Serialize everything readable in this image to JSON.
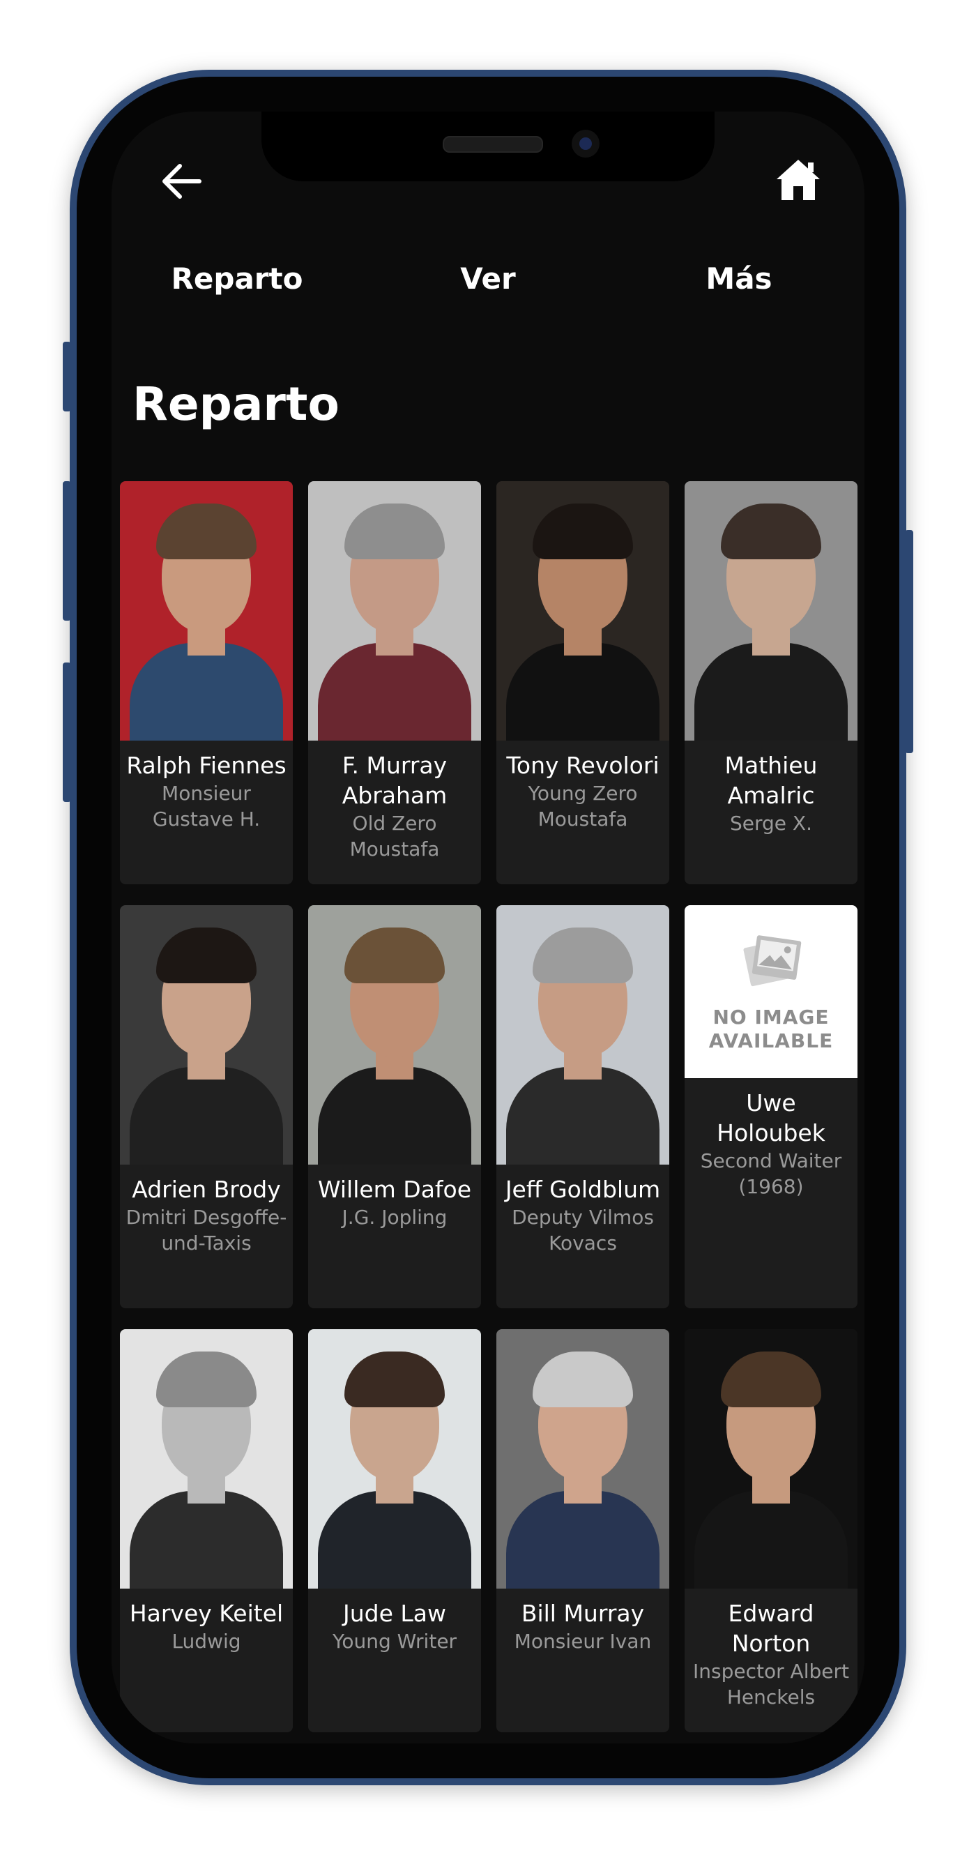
{
  "nav": {
    "back_icon": "arrow-left-icon",
    "home_icon": "home-icon",
    "tabs": [
      {
        "label": "Reparto"
      },
      {
        "label": "Ver"
      },
      {
        "label": "Más"
      }
    ]
  },
  "section": {
    "title": "Reparto"
  },
  "no_image": {
    "line1": "NO IMAGE",
    "line2": "AVAILABLE"
  },
  "cast": [
    {
      "name": "Ralph Fiennes",
      "role": "Monsieur Gustave H.",
      "bg": "#b0222a",
      "skin": "#c99a7e",
      "hair": "#5b4331",
      "cloth": "#2d4a6e"
    },
    {
      "name": "F. Murray Abraham",
      "role": "Old Zero Moustafa",
      "bg": "#bfbfbf",
      "skin": "#c49a86",
      "hair": "#8e8e8e",
      "cloth": "#6a2730"
    },
    {
      "name": "Tony Revolori",
      "role": "Young Zero Moustafa",
      "bg": "#2b2622",
      "skin": "#b58466",
      "hair": "#1b1512",
      "cloth": "#111111"
    },
    {
      "name": "Mathieu Amalric",
      "role": "Serge X.",
      "bg": "#8f8f8f",
      "skin": "#c7a690",
      "hair": "#3a2e28",
      "cloth": "#1b1b1b"
    },
    {
      "name": "Adrien Brody",
      "role": "Dmitri Desgoffe-und-Taxis",
      "bg": "#3a3a3a",
      "skin": "#c9a28a",
      "hair": "#1d1714",
      "cloth": "#202020"
    },
    {
      "name": "Willem Dafoe",
      "role": "J.G. Jopling",
      "bg": "#9ea19c",
      "skin": "#c08f74",
      "hair": "#6b5238",
      "cloth": "#1b1b1b"
    },
    {
      "name": "Jeff Goldblum",
      "role": "Deputy Vilmos Kovacs",
      "bg": "#c3c7cc",
      "skin": "#c69c84",
      "hair": "#9c9c9c",
      "cloth": "#2a2a2a"
    },
    {
      "name": "Uwe Holoubek",
      "role": "Second Waiter (1968)",
      "noimage": true
    },
    {
      "name": "Harvey Keitel",
      "role": "Ludwig",
      "bg": "#e3e3e3",
      "skin": "#b9b9b9",
      "hair": "#8a8a8a",
      "cloth": "#2c2c2c"
    },
    {
      "name": "Jude Law",
      "role": "Young Writer",
      "bg": "#dfe3e4",
      "skin": "#c9a58e",
      "hair": "#3a2a22",
      "cloth": "#20242a"
    },
    {
      "name": "Bill Murray",
      "role": "Monsieur Ivan",
      "bg": "#6f6f6f",
      "skin": "#cfa48c",
      "hair": "#c9c9c9",
      "cloth": "#283552"
    },
    {
      "name": "Edward Norton",
      "role": "Inspector Albert Henckels",
      "bg": "#111111",
      "skin": "#c69a7e",
      "hair": "#4b3626",
      "cloth": "#151515"
    }
  ]
}
